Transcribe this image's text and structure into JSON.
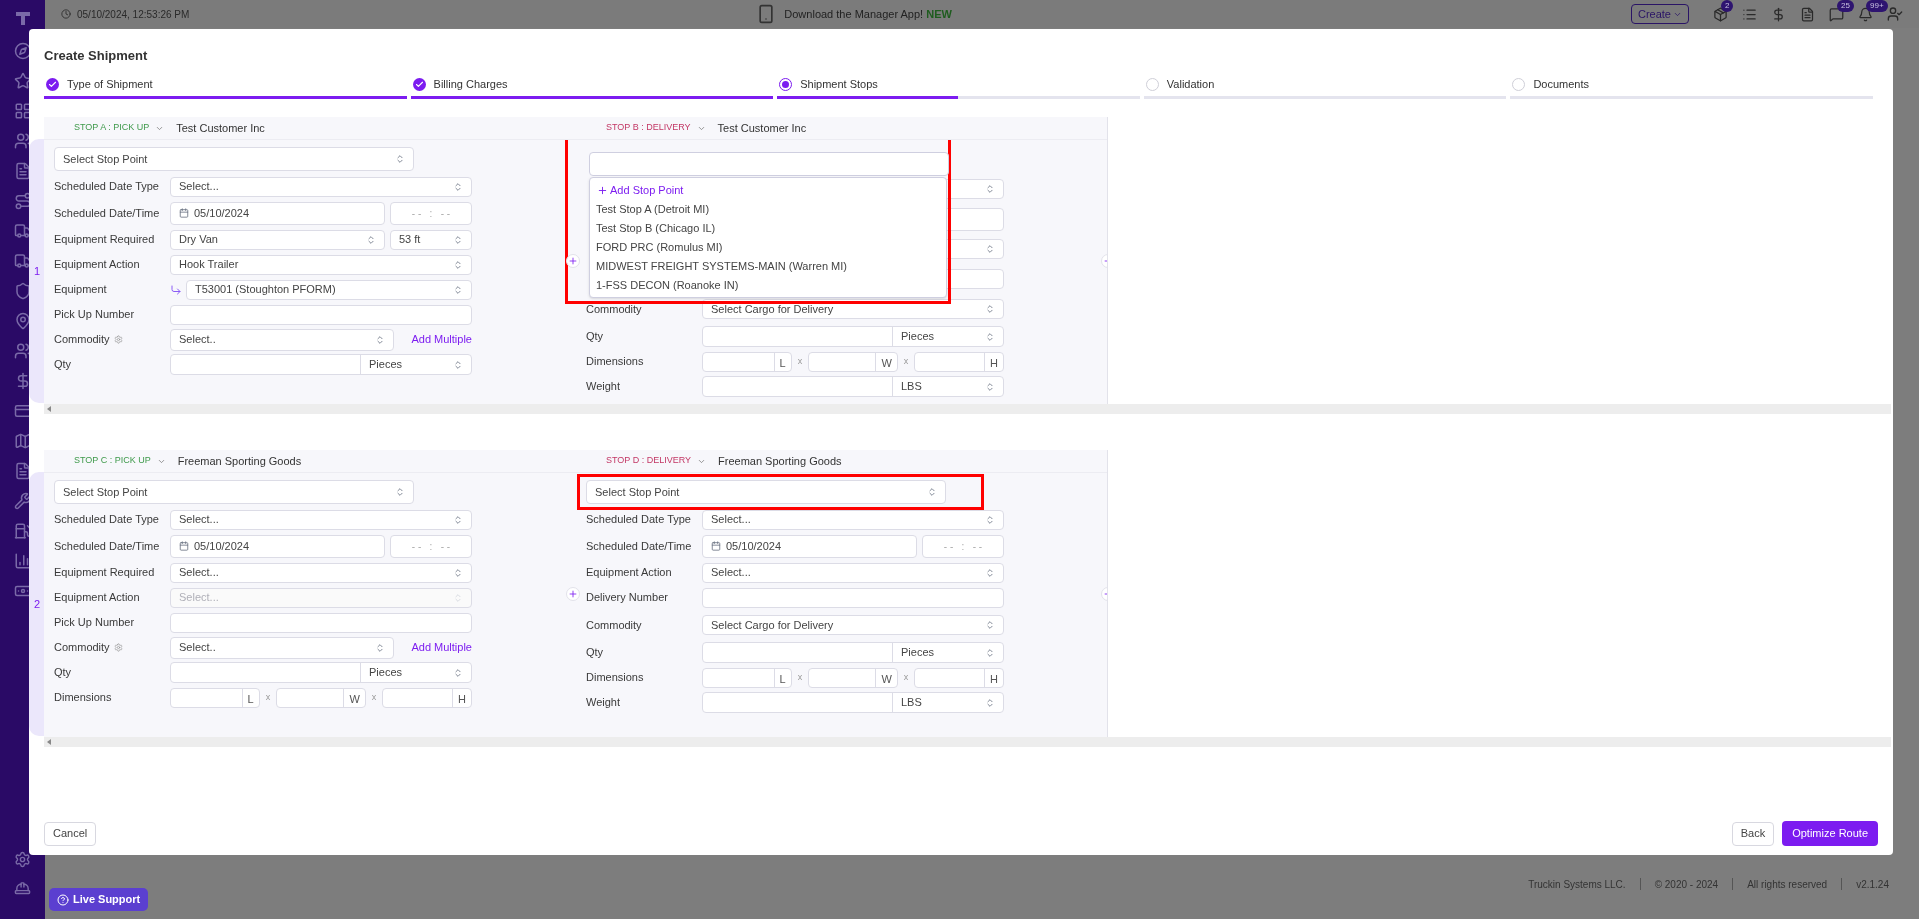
{
  "top_bar": {
    "datetime": "05/10/2024, 12:53:26 PM",
    "promo": "Download the Manager App!",
    "promo_badge": "NEW",
    "create_button": "Create",
    "badges": [
      "2",
      "25",
      "99+"
    ]
  },
  "dialog": {
    "title": "Create Shipment",
    "steps": [
      {
        "label": "Type of Shipment",
        "kind": "done",
        "level": 1
      },
      {
        "label": "Billing Charges",
        "kind": "done",
        "level": 1
      },
      {
        "label": "Shipment Stops",
        "kind": "current",
        "level": 0.5
      },
      {
        "label": "Validation",
        "kind": "pending",
        "level": 0
      },
      {
        "label": "Documents",
        "kind": "pending",
        "level": 0
      }
    ],
    "stop_groups": [
      {
        "number": "1",
        "stops": [
          {
            "code": "STOP A : PICK UP",
            "kind": "pickup",
            "customer": "Test Customer Inc",
            "stop_point": {
              "placeholder": "Select Stop Point",
              "open": false,
              "highlighted": false
            },
            "rows": [
              {
                "kind": "select",
                "label": "Scheduled Date Type",
                "value": "Select...",
                "disabled": false
              },
              {
                "kind": "date",
                "label": "Scheduled Date/Time",
                "date": "05/10/2024",
                "time": "- -   :   - -"
              },
              {
                "kind": "select_pair",
                "label": "Equipment Required",
                "value": "Dry Van",
                "unit": "53 ft"
              },
              {
                "kind": "select",
                "label": "Equipment Action",
                "value": "Hook Trailer",
                "disabled": false
              },
              {
                "kind": "equipment",
                "label": "Equipment",
                "value": "T53001 (Stoughton PFORM)"
              },
              {
                "kind": "input",
                "label": "Pick Up Number"
              },
              {
                "kind": "select_link",
                "label": "Commodity",
                "info": true,
                "value": "Select..",
                "link": "Add Multiple"
              },
              {
                "kind": "qty",
                "label": "Qty",
                "unit": "Pieces"
              }
            ]
          },
          {
            "code": "STOP B : DELIVERY",
            "kind": "delivery",
            "customer": "Test Customer Inc",
            "stop_point": {
              "open": true,
              "highlighted": true,
              "add_label": "Add Stop Point",
              "options": [
                "Test Stop A (Detroit MI)",
                "Test Stop B (Chicago IL)",
                "FORD PRC (Romulus MI)",
                "MIDWEST FREIGHT SYSTEMS-MAIN (Warren MI)",
                "1-FSS DECON (Roanoke IN)"
              ]
            },
            "rows": [
              {
                "kind": "select",
                "disabled": false
              },
              {
                "kind": "date"
              },
              {
                "kind": "select",
                "disabled": false
              },
              {
                "kind": "input"
              },
              {
                "kind": "select",
                "label": "Commodity",
                "value": "Select Cargo for Delivery",
                "disabled": false
              },
              {
                "kind": "qty",
                "label": "Qty",
                "unit": "Pieces"
              },
              {
                "kind": "dimensions",
                "label": "Dimensions",
                "units": [
                  "L",
                  "W",
                  "H"
                ],
                "separators": [
                  "x",
                  "x"
                ]
              },
              {
                "kind": "qty",
                "label": "Weight",
                "unit": "LBS"
              }
            ]
          }
        ]
      },
      {
        "number": "2",
        "stops": [
          {
            "code": "STOP C : PICK UP",
            "kind": "pickup",
            "customer": "Freeman Sporting Goods",
            "stop_point": {
              "placeholder": "Select Stop Point",
              "open": false,
              "highlighted": false
            },
            "rows": [
              {
                "kind": "select",
                "label": "Scheduled Date Type",
                "value": "Select...",
                "disabled": false
              },
              {
                "kind": "date",
                "label": "Scheduled Date/Time",
                "date": "05/10/2024",
                "time": "- -   :   - -"
              },
              {
                "kind": "select",
                "label": "Equipment Required",
                "value": "Select...",
                "disabled": false
              },
              {
                "kind": "select",
                "label": "Equipment Action",
                "value": "Select...",
                "disabled": true
              },
              {
                "kind": "input",
                "label": "Pick Up Number"
              },
              {
                "kind": "select_link",
                "label": "Commodity",
                "info": true,
                "value": "Select..",
                "link": "Add Multiple"
              },
              {
                "kind": "qty",
                "label": "Qty",
                "unit": "Pieces"
              },
              {
                "kind": "dimensions",
                "label": "Dimensions",
                "units": [
                  "L",
                  "W",
                  "H"
                ],
                "separators": [
                  "x",
                  "x"
                ]
              }
            ]
          },
          {
            "code": "STOP D : DELIVERY",
            "kind": "delivery",
            "customer": "Freeman Sporting Goods",
            "stop_point": {
              "placeholder": "Select Stop Point",
              "open": false,
              "highlighted": true
            },
            "rows": [
              {
                "kind": "select",
                "label": "Scheduled Date Type",
                "value": "Select...",
                "disabled": false
              },
              {
                "kind": "date",
                "label": "Scheduled Date/Time",
                "date": "05/10/2024",
                "time": "- -   :   - -"
              },
              {
                "kind": "select",
                "label": "Equipment Action",
                "value": "Select...",
                "disabled": false
              },
              {
                "kind": "input",
                "label": "Delivery Number"
              },
              {
                "kind": "select",
                "label": "Commodity",
                "value": "Select Cargo for Delivery",
                "disabled": false
              },
              {
                "kind": "qty",
                "label": "Qty",
                "unit": "Pieces"
              },
              {
                "kind": "dimensions",
                "label": "Dimensions",
                "units": [
                  "L",
                  "W",
                  "H"
                ],
                "separators": [
                  "x",
                  "x"
                ]
              },
              {
                "kind": "qty",
                "label": "Weight",
                "unit": "LBS"
              }
            ]
          }
        ]
      }
    ],
    "buttons": {
      "cancel": "Cancel",
      "back": "Back",
      "primary": "Optimize Route"
    }
  },
  "footer": {
    "company": "Truckin Systems LLC.",
    "copyright": "© 2020 - 2024",
    "rights": "All rights reserved",
    "version": "v2.1.24"
  },
  "live_support": "Live Support"
}
